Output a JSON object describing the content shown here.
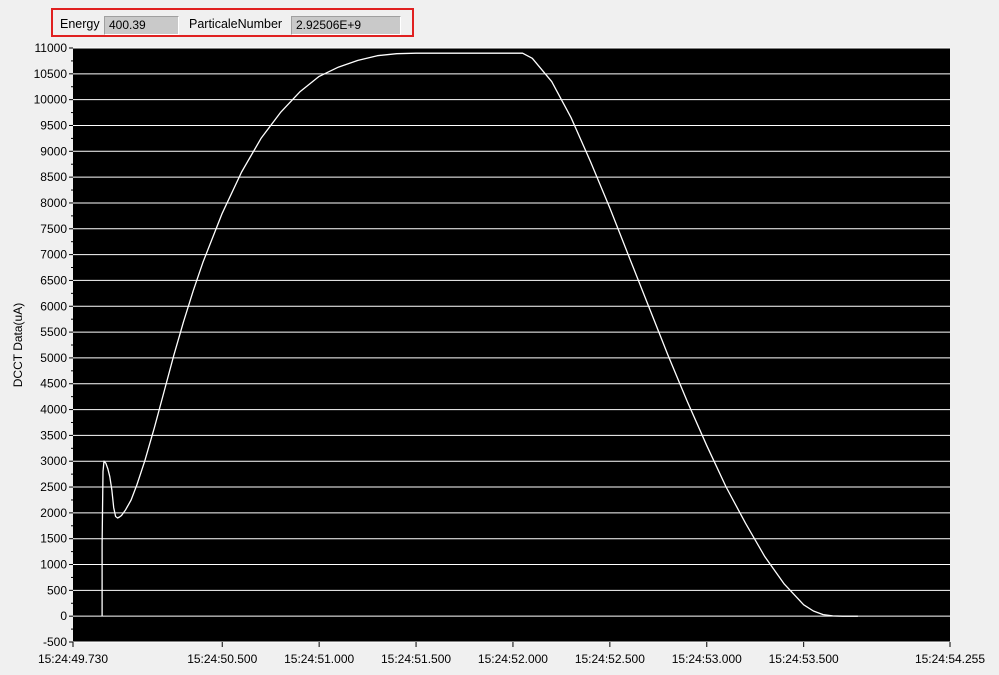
{
  "indicators": {
    "energy": {
      "label": "Energy",
      "value": "400.39"
    },
    "particle_number": {
      "label": "ParticaleNumber",
      "value": "2.92506E+9"
    }
  },
  "chart_data": {
    "type": "line",
    "ylabel": "DCCT Data(uA)",
    "xlabel": "",
    "ylim": [
      -500,
      11000
    ],
    "yticks": [
      -500,
      0,
      500,
      1000,
      1500,
      2000,
      2500,
      3000,
      3500,
      4000,
      4500,
      5000,
      5500,
      6000,
      6500,
      7000,
      7500,
      8000,
      8500,
      9000,
      9500,
      10000,
      10500,
      11000
    ],
    "ytick_labels": [
      "-500",
      "0",
      "500",
      "1000",
      "1500",
      "2000",
      "2500",
      "3000",
      "3500",
      "4000",
      "4500",
      "5000",
      "5500",
      "6000",
      "6500",
      "7000",
      "7500",
      "8000",
      "8500",
      "9000",
      "9500",
      "10000",
      "10500",
      "11000"
    ],
    "xlim_seconds": [
      49.73,
      54.255
    ],
    "xticks_seconds": [
      49.73,
      50.5,
      51.0,
      51.5,
      52.0,
      52.5,
      53.0,
      53.5,
      54.255
    ],
    "xtick_labels": [
      "15:24:49.730",
      "15:24:50.500",
      "15:24:51.000",
      "15:24:51.500",
      "15:24:52.000",
      "15:24:52.500",
      "15:24:53.000",
      "15:24:53.500",
      "15:24:54.255"
    ],
    "grid": true,
    "colors": {
      "plot_background": "#000000",
      "grid": "#ffffff",
      "line": "#ffffff"
    },
    "series": [
      {
        "x_seconds": [
          49.88,
          49.88,
          49.885,
          49.89,
          49.9,
          49.91,
          49.92,
          49.93,
          49.94,
          49.95,
          49.96,
          49.97,
          49.98,
          50.0,
          50.03,
          50.06,
          50.1,
          50.15,
          50.2,
          50.25,
          50.3,
          50.35,
          50.4,
          50.5,
          50.6,
          50.7,
          50.8,
          50.9,
          51.0,
          51.1,
          51.2,
          51.3,
          51.4,
          51.5,
          51.6,
          51.65,
          51.7,
          51.8,
          51.9,
          51.95,
          52.0,
          52.05,
          52.1,
          52.2,
          52.3,
          52.4,
          52.5,
          52.6,
          52.7,
          52.8,
          52.9,
          53.0,
          53.1,
          53.2,
          53.3,
          53.4,
          53.5,
          53.55,
          53.6,
          53.65,
          53.7,
          53.75,
          53.78
        ],
        "y": [
          0,
          1400,
          2800,
          3000,
          2960,
          2850,
          2700,
          2450,
          2100,
          1930,
          1900,
          1920,
          1950,
          2050,
          2250,
          2550,
          3000,
          3650,
          4350,
          5050,
          5700,
          6300,
          6850,
          7800,
          8600,
          9250,
          9750,
          10150,
          10450,
          10630,
          10760,
          10850,
          10890,
          10900,
          10900,
          10900,
          10900,
          10900,
          10900,
          10900,
          10900,
          10900,
          10800,
          10350,
          9650,
          8800,
          7900,
          6950,
          6000,
          5050,
          4150,
          3300,
          2500,
          1800,
          1150,
          620,
          220,
          100,
          30,
          5,
          0,
          0,
          0
        ]
      }
    ]
  }
}
